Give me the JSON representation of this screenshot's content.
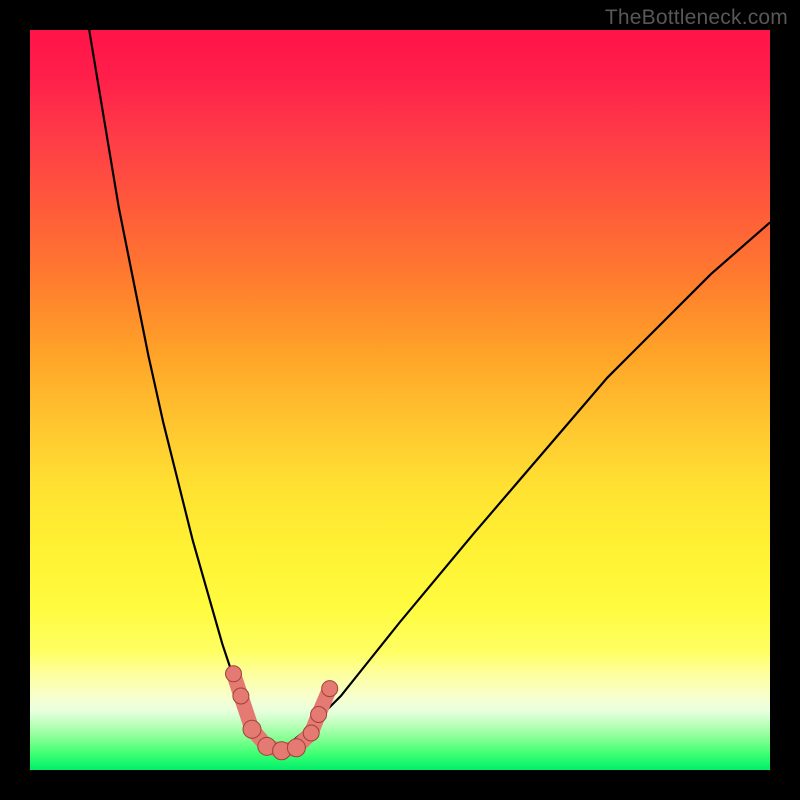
{
  "watermark": "TheBottleneck.com",
  "colors": {
    "frame": "#000000",
    "curve": "#000000",
    "marker_fill": "#e47a71",
    "marker_stroke": "#9e423b",
    "gradient_stops": [
      "#ff1448",
      "#ff1e4a",
      "#ff3a48",
      "#ff5a3a",
      "#ff7d2e",
      "#ffa428",
      "#ffc830",
      "#ffe232",
      "#fff133",
      "#fffb3f",
      "#ffff63",
      "#fdff9e",
      "#f8ffde",
      "#b8ffb8",
      "#7cff8e",
      "#38ff72",
      "#00ee6b"
    ]
  },
  "chart_data": {
    "type": "line",
    "title": "",
    "xlabel": "",
    "ylabel": "",
    "xlim": [
      0,
      100
    ],
    "ylim": [
      0,
      100
    ],
    "note": "Bottleneck-style V-curve; y is percentage mismatch, x is component ratio. Minimum near x≈33.",
    "left_curve": {
      "x": [
        8,
        10,
        12,
        14,
        16,
        18,
        20,
        22,
        24,
        26,
        27,
        28,
        29,
        30,
        31,
        32,
        33
      ],
      "y": [
        100,
        88,
        76,
        66,
        56,
        47,
        39,
        31,
        24,
        17,
        14,
        11,
        9,
        7,
        5,
        3.5,
        2.5
      ]
    },
    "right_curve": {
      "x": [
        33,
        35,
        38,
        42,
        46,
        50,
        55,
        60,
        66,
        72,
        78,
        85,
        92,
        100
      ],
      "y": [
        2.5,
        3.5,
        6,
        10,
        15,
        20,
        26,
        32,
        39,
        46,
        53,
        60,
        67,
        74
      ]
    },
    "markers": [
      {
        "x": 27.5,
        "y": 13,
        "r": 8
      },
      {
        "x": 28.5,
        "y": 10,
        "r": 8
      },
      {
        "x": 30.0,
        "y": 5.5,
        "r": 9
      },
      {
        "x": 32.0,
        "y": 3.2,
        "r": 9
      },
      {
        "x": 34.0,
        "y": 2.6,
        "r": 9
      },
      {
        "x": 36.0,
        "y": 3.0,
        "r": 9
      },
      {
        "x": 38.0,
        "y": 5.0,
        "r": 8
      },
      {
        "x": 39.0,
        "y": 7.5,
        "r": 8
      },
      {
        "x": 40.5,
        "y": 11.0,
        "r": 8
      }
    ]
  }
}
